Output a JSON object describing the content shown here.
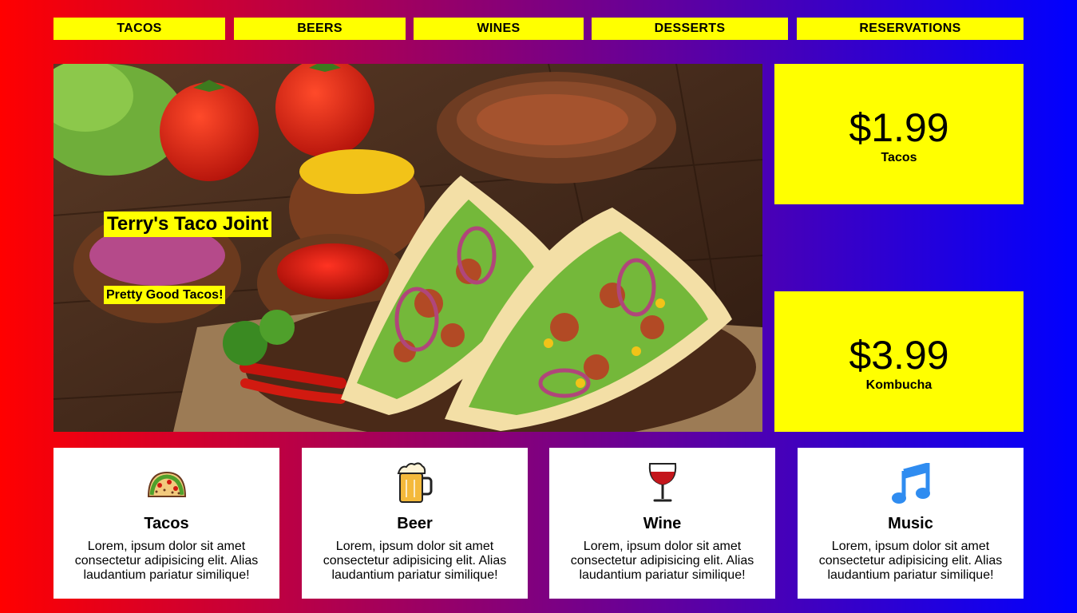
{
  "nav": {
    "items": [
      {
        "label": "TACOS"
      },
      {
        "label": "BEERS"
      },
      {
        "label": "WINES"
      },
      {
        "label": "DESSERTS"
      },
      {
        "label": "RESERVATIONS"
      }
    ]
  },
  "hero": {
    "title": "Terry's Taco Joint",
    "tagline": "Pretty Good Tacos!"
  },
  "prices": [
    {
      "amount": "$1.99",
      "item": "Tacos"
    },
    {
      "amount": "$3.99",
      "item": "Kombucha"
    }
  ],
  "cards": [
    {
      "icon": "taco-icon",
      "title": "Tacos",
      "text": "Lorem, ipsum dolor sit amet consectetur adipisicing elit. Alias laudantium pariatur similique!"
    },
    {
      "icon": "beer-mug-icon",
      "title": "Beer",
      "text": "Lorem, ipsum dolor sit amet consectetur adipisicing elit. Alias laudantium pariatur similique!"
    },
    {
      "icon": "wine-glass-icon",
      "title": "Wine",
      "text": "Lorem, ipsum dolor sit amet consectetur adipisicing elit. Alias laudantium pariatur similique!"
    },
    {
      "icon": "music-note-icon",
      "title": "Music",
      "text": "Lorem, ipsum dolor sit amet consectetur adipisicing elit. Alias laudantium pariatur similique!"
    }
  ],
  "colors": {
    "gradient_start": "#ff0000",
    "gradient_end": "#0000ff",
    "accent": "#ffff00",
    "card_bg": "#ffffff"
  }
}
